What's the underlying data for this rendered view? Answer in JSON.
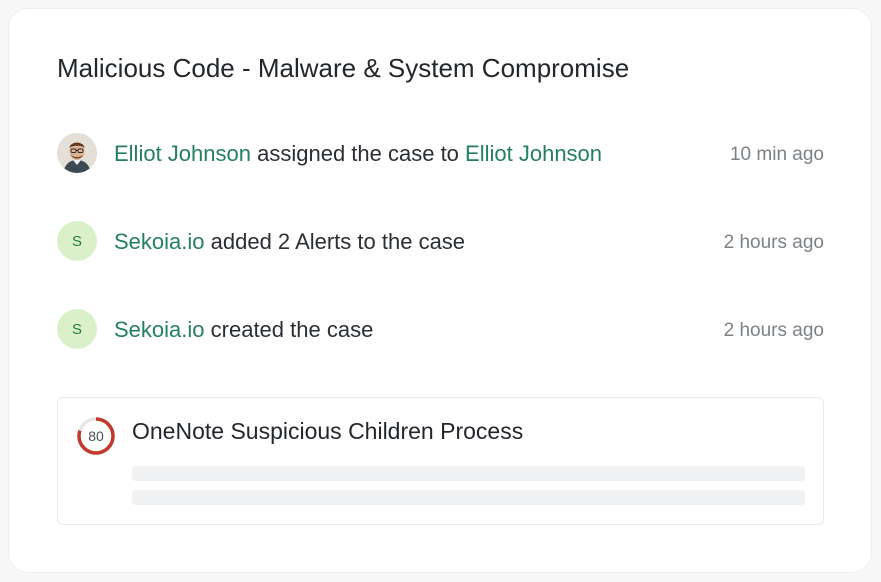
{
  "case": {
    "title": "Malicious Code - Malware & System Compromise"
  },
  "activity": [
    {
      "actor": "Elliot Johnson",
      "action": "assigned the case to",
      "target": "Elliot Johnson",
      "time": "10 min ago",
      "avatar": "photo"
    },
    {
      "actor": "Sekoia.io",
      "action": "added 2 Alerts to the case",
      "time": "2 hours ago",
      "avatar_letter": "S"
    },
    {
      "actor": "Sekoia.io",
      "action": "created the case",
      "time": "2 hours ago",
      "avatar_letter": "S"
    }
  ],
  "alert": {
    "score": "80",
    "score_fraction": 0.8,
    "score_color": "#c0392b",
    "title": "OneNote Suspicious Children Process"
  },
  "colors": {
    "link": "#25805f",
    "avatar_bg": "#d9f0c9"
  }
}
